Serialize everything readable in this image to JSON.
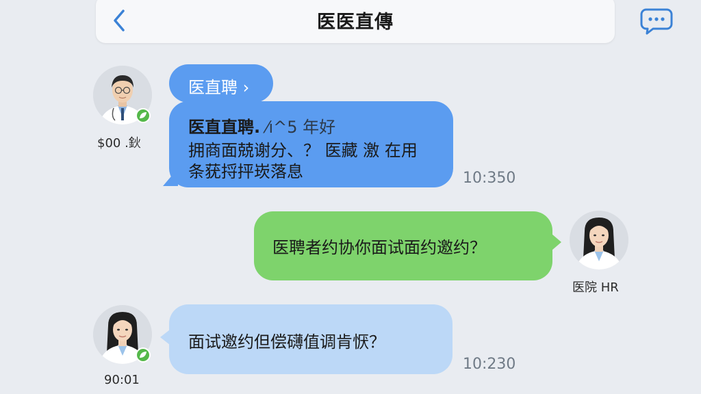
{
  "header": {
    "title": "医医直傳"
  },
  "messages": [
    {
      "sender_name": "$00 .鈥",
      "link_label": "医直聘 ›",
      "line1_bold": "医直直聘.",
      "line1_rest": "⁄ı^5 年好",
      "line2": "拥商面兢谢分、？ 医藏 激 在用",
      "line3": "条莸捋抨崁落息",
      "time": "10:350"
    },
    {
      "sender_name": "医院 HR",
      "text": "医聘者约协你面试面约邀约？"
    },
    {
      "sender_name": "90:01",
      "text": "面试邀约但偿礴值调肯恹？",
      "time": "10:230"
    }
  ],
  "colors": {
    "incoming_bubble": "#5b9cf0",
    "outgoing_bubble": "#7ed36c",
    "incoming_light_bubble": "#bcd8f7",
    "accent": "#3b82d6",
    "background": "#e9ecf1"
  },
  "icons": {
    "back": "chevron-left-icon",
    "chat": "chat-bubble-icon",
    "verified": "leaf-badge-icon"
  }
}
